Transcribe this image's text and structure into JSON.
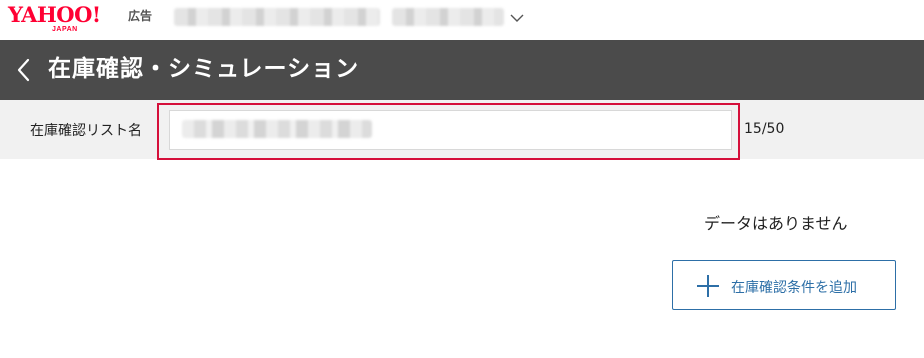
{
  "header": {
    "logo_text": "YAHOO!",
    "logo_subtext": "JAPAN",
    "logo_suffix": "広告",
    "brand_color": "#ff0033"
  },
  "titlebar": {
    "title": "在庫確認・シミュレーション",
    "back_icon": "chevron-left-icon",
    "background": "#4b4b4b"
  },
  "name_row": {
    "label": "在庫確認リスト名",
    "char_count": "15/50",
    "highlight_color": "#d50f3a"
  },
  "main": {
    "empty_message": "データはありません",
    "add_button_label": "在庫確認条件を追加",
    "add_button_icon": "plus-icon",
    "accent_color": "#2d6fa7"
  }
}
